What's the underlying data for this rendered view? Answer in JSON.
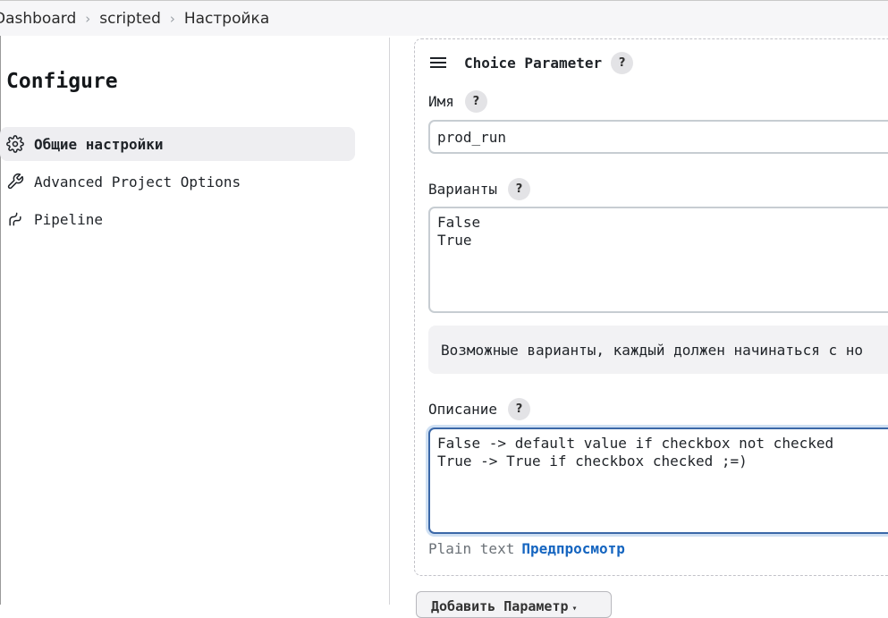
{
  "breadcrumb": {
    "items": [
      "Dashboard",
      "scripted",
      "Настройка"
    ],
    "separator": "›"
  },
  "sidebar": {
    "heading": "Configure",
    "items": [
      {
        "label": "Общие настройки",
        "icon": "gear-icon",
        "active": true
      },
      {
        "label": "Advanced Project Options",
        "icon": "wrench-icon",
        "active": false
      },
      {
        "label": "Pipeline",
        "icon": "pipeline-icon",
        "active": false
      }
    ]
  },
  "parameter": {
    "title": "Choice Parameter",
    "help_label": "?",
    "name_label": "Имя",
    "name_value": "prod_run",
    "choices_label": "Варианты",
    "choices_value": "False\nTrue",
    "choices_hint": "Возможные варианты, каждый должен начинаться с но",
    "description_label": "Описание",
    "description_value": "False -> default value if checkbox not checked\nTrue -> True if checkbox checked ;=)",
    "format_plain": "Plain text",
    "format_preview": "Предпросмотр"
  },
  "add_parameter": {
    "label": "Добавить Параметр",
    "caret": "▾"
  },
  "colors": {
    "breadcrumb_bg": "#f6f6f8",
    "active_item_bg": "#eeeef1",
    "link": "#1565c0",
    "focus_border": "#3b68a8"
  }
}
